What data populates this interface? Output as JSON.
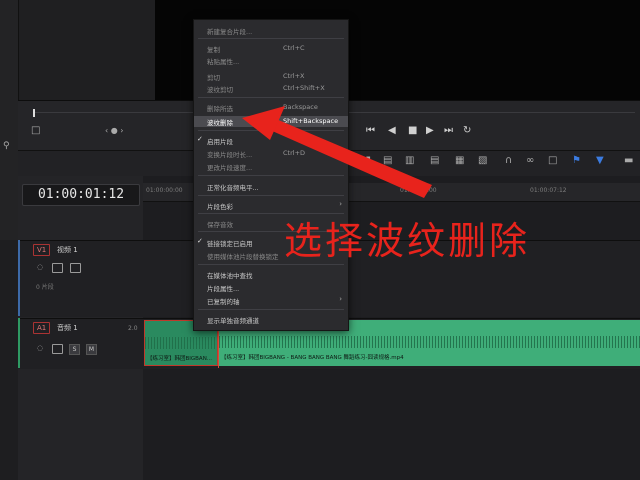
{
  "timecode": "01:00:01:12",
  "ruler": {
    "start": "01:00:00:00",
    "mid": "01:00:03:00",
    "end": "01:00:07:12"
  },
  "tracks": {
    "video": {
      "tag": "V1",
      "name": "视频 1",
      "status": "0 片段"
    },
    "audio": {
      "tag": "A1",
      "name": "音频 1",
      "level": "2.0",
      "solo": "S",
      "mute": "M"
    }
  },
  "clips": {
    "clip1_label": "【练习室】韩团BIGBAN...",
    "clip2_label": "【练习室】韩团BIGBANG - BANG BANG BANG 舞蹈练习-囧读规格.mp4"
  },
  "menu": {
    "items": [
      {
        "label": "新建复合片段...",
        "shortcut": "",
        "state": "disabled"
      },
      {
        "label": "复制",
        "shortcut": "Ctrl+C",
        "state": "disabled"
      },
      {
        "label": "粘贴属性...",
        "shortcut": "",
        "state": "disabled"
      },
      {
        "label": "剪切",
        "shortcut": "Ctrl+X",
        "state": "disabled"
      },
      {
        "label": "波纹剪切",
        "shortcut": "Ctrl+Shift+X",
        "state": "disabled"
      },
      {
        "label": "删除所选",
        "shortcut": "Backspace",
        "state": "disabled"
      },
      {
        "label": "波纹删除",
        "shortcut": "Shift+Backspace",
        "state": "highlighted"
      },
      {
        "label": "启用片段",
        "shortcut": "",
        "state": "enabled",
        "checked": true
      },
      {
        "label": "变换片段时长...",
        "shortcut": "Ctrl+D",
        "state": "disabled"
      },
      {
        "label": "更改片段速度...",
        "shortcut": "",
        "state": "disabled"
      },
      {
        "label": "正常化音频电平...",
        "shortcut": "",
        "state": "enabled"
      },
      {
        "label": "片段色彩",
        "shortcut": "",
        "state": "enabled",
        "submenu": true
      },
      {
        "label": "保存音效",
        "shortcut": "",
        "state": "disabled"
      },
      {
        "label": "链接锁定已启用",
        "shortcut": "",
        "state": "enabled",
        "checked": true
      },
      {
        "label": "使用媒体池片段替换锁定",
        "shortcut": "",
        "state": "disabled"
      },
      {
        "label": "在媒体池中查找",
        "shortcut": "",
        "state": "enabled"
      },
      {
        "label": "片段属性...",
        "shortcut": "",
        "state": "enabled"
      },
      {
        "label": "已复制的轴",
        "shortcut": "",
        "state": "enabled",
        "submenu": true
      },
      {
        "label": "显示单独音频通道",
        "shortcut": "",
        "state": "enabled"
      }
    ]
  },
  "annotation": "选择波纹删除",
  "colors": {
    "annotation": "#e8231c",
    "audio_clip": "#3fae79",
    "highlight": "#4b4b50"
  }
}
